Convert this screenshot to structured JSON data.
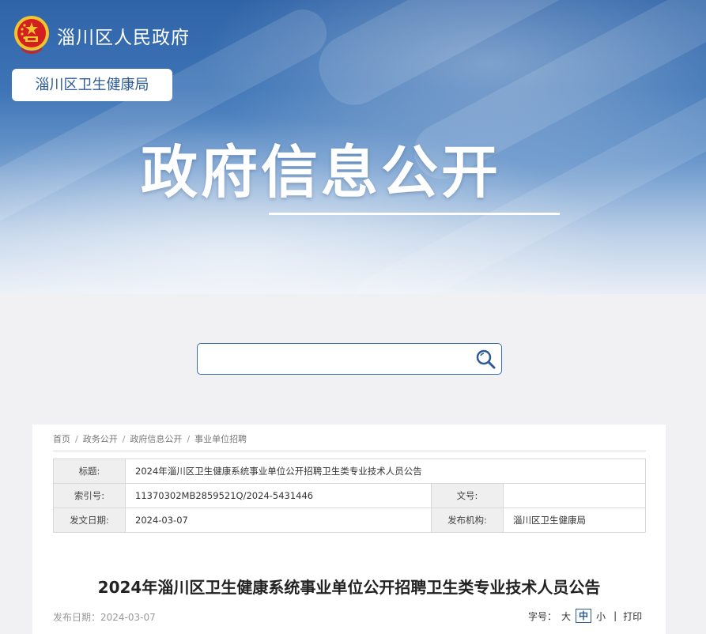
{
  "header": {
    "site_name": "淄川区人民政府",
    "department": "淄川区卫生健康局",
    "hero_title": "政府信息公开"
  },
  "search": {
    "placeholder": ""
  },
  "breadcrumb": {
    "items": [
      "首页",
      "政务公开",
      "政府信息公开",
      "事业单位招聘"
    ],
    "separator": "/"
  },
  "meta": {
    "title_label": "标题:",
    "title_value": "2024年淄川区卫生健康系统事业单位公开招聘卫生类专业技术人员公告",
    "index_label": "索引号:",
    "index_value": "11370302MB2859521Q/2024-5431446",
    "docno_label": "文号:",
    "docno_value": "",
    "date_label": "发文日期:",
    "date_value": "2024-03-07",
    "org_label": "发布机构:",
    "org_value": "淄川区卫生健康局"
  },
  "article": {
    "title": "2024年淄川区卫生健康系统事业单位公开招聘卫生类专业技术人员公告",
    "pub_date": "发布日期：2024-03-07"
  },
  "font_size": {
    "label": "字号：",
    "large": "大",
    "medium": "中",
    "small": "小",
    "divider": "|",
    "print": "打印",
    "selected": "中"
  },
  "colors": {
    "accent": "#2b5a96",
    "emblem_red": "#d21f1f",
    "emblem_gold": "#f4c430"
  }
}
